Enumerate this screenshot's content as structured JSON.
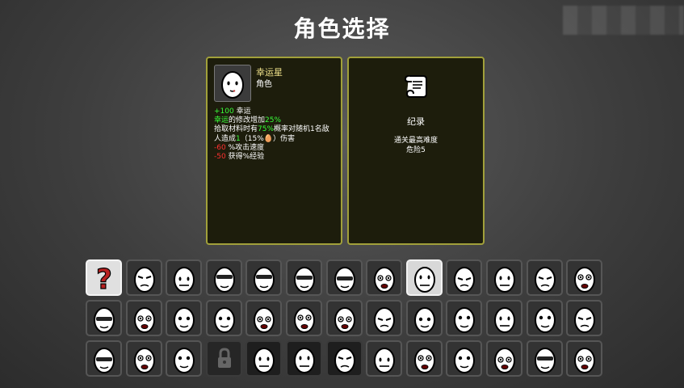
{
  "title": "角色选择",
  "character": {
    "name": "幸运星",
    "type": "角色",
    "stats": [
      {
        "parts": [
          {
            "text": "+100",
            "color": "g"
          },
          {
            "text": " 幸运"
          }
        ]
      },
      {
        "parts": [
          {
            "text": "幸运",
            "color": "g"
          },
          {
            "text": "的修改增加"
          },
          {
            "text": "25%",
            "color": "g"
          }
        ]
      },
      {
        "parts": [
          {
            "text": "拾取材料时有"
          },
          {
            "text": "75%",
            "color": "g"
          },
          {
            "text": "概率对随机1名敌"
          }
        ]
      },
      {
        "parts": [
          {
            "text": "人造成"
          },
          {
            "text": "1",
            "color": "g"
          },
          {
            "text": "（15%🥚）伤害"
          }
        ]
      },
      {
        "parts": [
          {
            "text": "-60",
            "color": "r"
          },
          {
            "text": " %攻击速度"
          }
        ]
      },
      {
        "parts": [
          {
            "text": "-50",
            "color": "r"
          },
          {
            "text": " 获得%经验"
          }
        ]
      }
    ]
  },
  "record": {
    "icon": "scroll-icon",
    "title": "纪录",
    "line1": "通关最高难度",
    "line2": "危险5"
  },
  "grid": {
    "rows": [
      [
        "random",
        "normal",
        "normal",
        "normal",
        "normal",
        "normal",
        "normal",
        "normal",
        "selected",
        "normal",
        "normal",
        "normal",
        "normal"
      ],
      [
        "normal",
        "normal",
        "normal",
        "normal",
        "normal",
        "normal",
        "normal",
        "normal",
        "normal",
        "normal",
        "normal",
        "normal",
        "normal"
      ],
      [
        "normal",
        "normal",
        "normal",
        "locked",
        "dark",
        "dark",
        "dark",
        "normal",
        "normal",
        "normal",
        "normal",
        "normal",
        "normal"
      ]
    ],
    "character_icons": [
      [
        "random-question-icon",
        "well-rounded-icon",
        "brawler-icon",
        "crazy-icon",
        "ranger-icon",
        "mage-icon",
        "chunky-icon",
        "old-icon",
        "lucky-icon",
        "mutant-icon",
        "generalist-icon",
        "loud-icon",
        "multitasker-icon"
      ],
      [
        "wildling-icon",
        "pacifist-icon",
        "gladiator-icon",
        "saver-icon",
        "sick-icon",
        "farmer-icon",
        "ghost-icon",
        "speedy-icon",
        "entrepreneur-icon",
        "engineer-icon",
        "explorer-icon",
        "doctor-icon",
        "hunter-icon"
      ],
      [
        "artificer-icon",
        "arms-dealer-icon",
        "streamer-icon",
        "lock-icon",
        "cyborg-icon",
        "glutton-icon",
        "jack-icon",
        "lich-icon",
        "apprentice-icon",
        "cryptid-icon",
        "fisherman-icon",
        "golem-icon",
        "king-icon"
      ]
    ]
  },
  "colors": {
    "panel_border": "#a1a03a",
    "panel_bg": "#1d1d0c",
    "positive": "#39ff3a",
    "negative": "#ff3030",
    "name": "#f0e28a"
  }
}
